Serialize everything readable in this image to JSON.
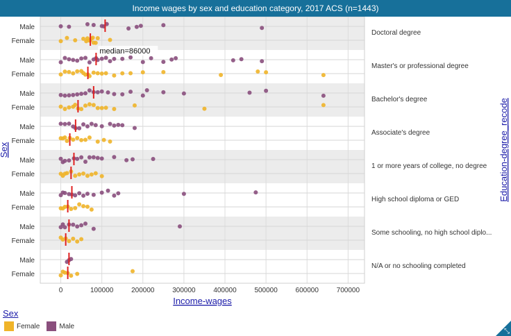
{
  "title": "Income wages by sex and education category, 2017 ACS (n=1443)",
  "x_axis_title": "Income-wages",
  "left_axis_title": "Sex",
  "right_axis_title": "Education-degree_recode",
  "legend": {
    "title": "Sex",
    "items": [
      {
        "label": "Female",
        "color": "#f0b429"
      },
      {
        "label": "Male",
        "color": "#8a4f7d"
      }
    ]
  },
  "colors": {
    "female": "#f0b429",
    "male": "#8a4f7d",
    "median": "#e02020",
    "band_gray": "#ececec",
    "band_white": "#ffffff",
    "header": "#17709a"
  },
  "corner_icon": "expand-arrows-icon",
  "chart_data": {
    "type": "scatter",
    "subtype": "jittered strip plot with median lines",
    "title": "Income wages by sex and education category, 2017 ACS (n=1443)",
    "xlabel": "Income-wages",
    "ylabel": "Sex",
    "y2label": "Education-degree_recode",
    "xlim": [
      -50000,
      740000
    ],
    "x_ticks": [
      0,
      100000,
      200000,
      300000,
      400000,
      500000,
      600000,
      700000
    ],
    "x_tick_labels": [
      "0",
      "100000",
      "200000",
      "300000",
      "400000",
      "500000",
      "600000",
      "700000"
    ],
    "grid": true,
    "legend_position": "bottom-left",
    "annotation": {
      "text": "median=86000",
      "category": "Master's or professional degree",
      "sex": "Male",
      "value": 86000
    },
    "categories": [
      {
        "label": "Doctoral degree",
        "male": {
          "median": 108000,
          "points": [
            0,
            20000,
            65000,
            80000,
            100000,
            105000,
            112000,
            165000,
            185000,
            195000,
            250000,
            490000
          ]
        },
        "female": {
          "median": 72000,
          "points": [
            0,
            15000,
            35000,
            55000,
            62000,
            65000,
            70000,
            72000,
            75000,
            78000,
            80000,
            85000,
            90000,
            120000
          ]
        }
      },
      {
        "label": "Master's or professional degree",
        "male": {
          "median": 86000,
          "points": [
            0,
            10000,
            20000,
            30000,
            40000,
            50000,
            60000,
            70000,
            80000,
            86000,
            90000,
            100000,
            110000,
            120000,
            130000,
            150000,
            170000,
            200000,
            220000,
            250000,
            270000,
            280000,
            420000,
            440000,
            490000
          ]
        },
        "female": {
          "median": 66000,
          "points": [
            0,
            10000,
            20000,
            30000,
            40000,
            50000,
            55000,
            60000,
            66000,
            70000,
            80000,
            90000,
            100000,
            110000,
            130000,
            150000,
            170000,
            200000,
            250000,
            390000,
            480000,
            500000,
            640000
          ]
        }
      },
      {
        "label": "Bachelor's degree",
        "male": {
          "median": 80000,
          "points": [
            0,
            10000,
            20000,
            30000,
            40000,
            50000,
            60000,
            70000,
            80000,
            90000,
            100000,
            115000,
            130000,
            150000,
            170000,
            200000,
            210000,
            250000,
            300000,
            460000,
            500000,
            640000
          ]
        },
        "female": {
          "median": 42000,
          "points": [
            0,
            10000,
            20000,
            30000,
            35000,
            42000,
            50000,
            60000,
            70000,
            80000,
            90000,
            100000,
            110000,
            130000,
            180000,
            350000,
            640000
          ]
        }
      },
      {
        "label": "Associate's degree",
        "male": {
          "median": 36000,
          "points": [
            0,
            10000,
            20000,
            30000,
            36000,
            45000,
            55000,
            65000,
            75000,
            85000,
            100000,
            120000,
            130000,
            140000,
            150000,
            180000
          ]
        },
        "female": {
          "median": 22000,
          "points": [
            0,
            5000,
            10000,
            15000,
            22000,
            30000,
            40000,
            50000,
            60000,
            70000,
            90000,
            105000,
            120000
          ]
        }
      },
      {
        "label": "1 or more years of college, no degree",
        "male": {
          "median": 32000,
          "points": [
            0,
            5000,
            10000,
            20000,
            32000,
            40000,
            50000,
            60000,
            70000,
            80000,
            90000,
            100000,
            130000,
            160000,
            175000,
            225000
          ]
        },
        "female": {
          "median": 25000,
          "points": [
            0,
            5000,
            10000,
            15000,
            25000,
            35000,
            45000,
            55000,
            65000,
            75000,
            85000,
            100000
          ]
        }
      },
      {
        "label": "High school diploma or GED",
        "male": {
          "median": 27000,
          "points": [
            0,
            5000,
            10000,
            20000,
            27000,
            35000,
            45000,
            55000,
            65000,
            80000,
            100000,
            115000,
            130000,
            140000,
            300000,
            475000
          ]
        },
        "female": {
          "median": 17000,
          "points": [
            0,
            5000,
            10000,
            17000,
            25000,
            35000,
            45000,
            55000,
            65000,
            75000
          ]
        }
      },
      {
        "label": "Some schooling, no high school diplo...",
        "male": {
          "median": 20000,
          "points": [
            0,
            5000,
            10000,
            20000,
            30000,
            40000,
            50000,
            60000,
            80000,
            290000
          ]
        },
        "female": {
          "median": 12000,
          "points": [
            0,
            5000,
            12000,
            20000,
            30000,
            40000,
            50000
          ]
        }
      },
      {
        "label": "N/A or no schooling completed",
        "male": {
          "median": 20000,
          "points": [
            15000,
            20000,
            25000
          ]
        },
        "female": {
          "median": 17000,
          "points": [
            0,
            5000,
            10000,
            17000,
            25000,
            40000,
            175000
          ]
        }
      }
    ]
  }
}
